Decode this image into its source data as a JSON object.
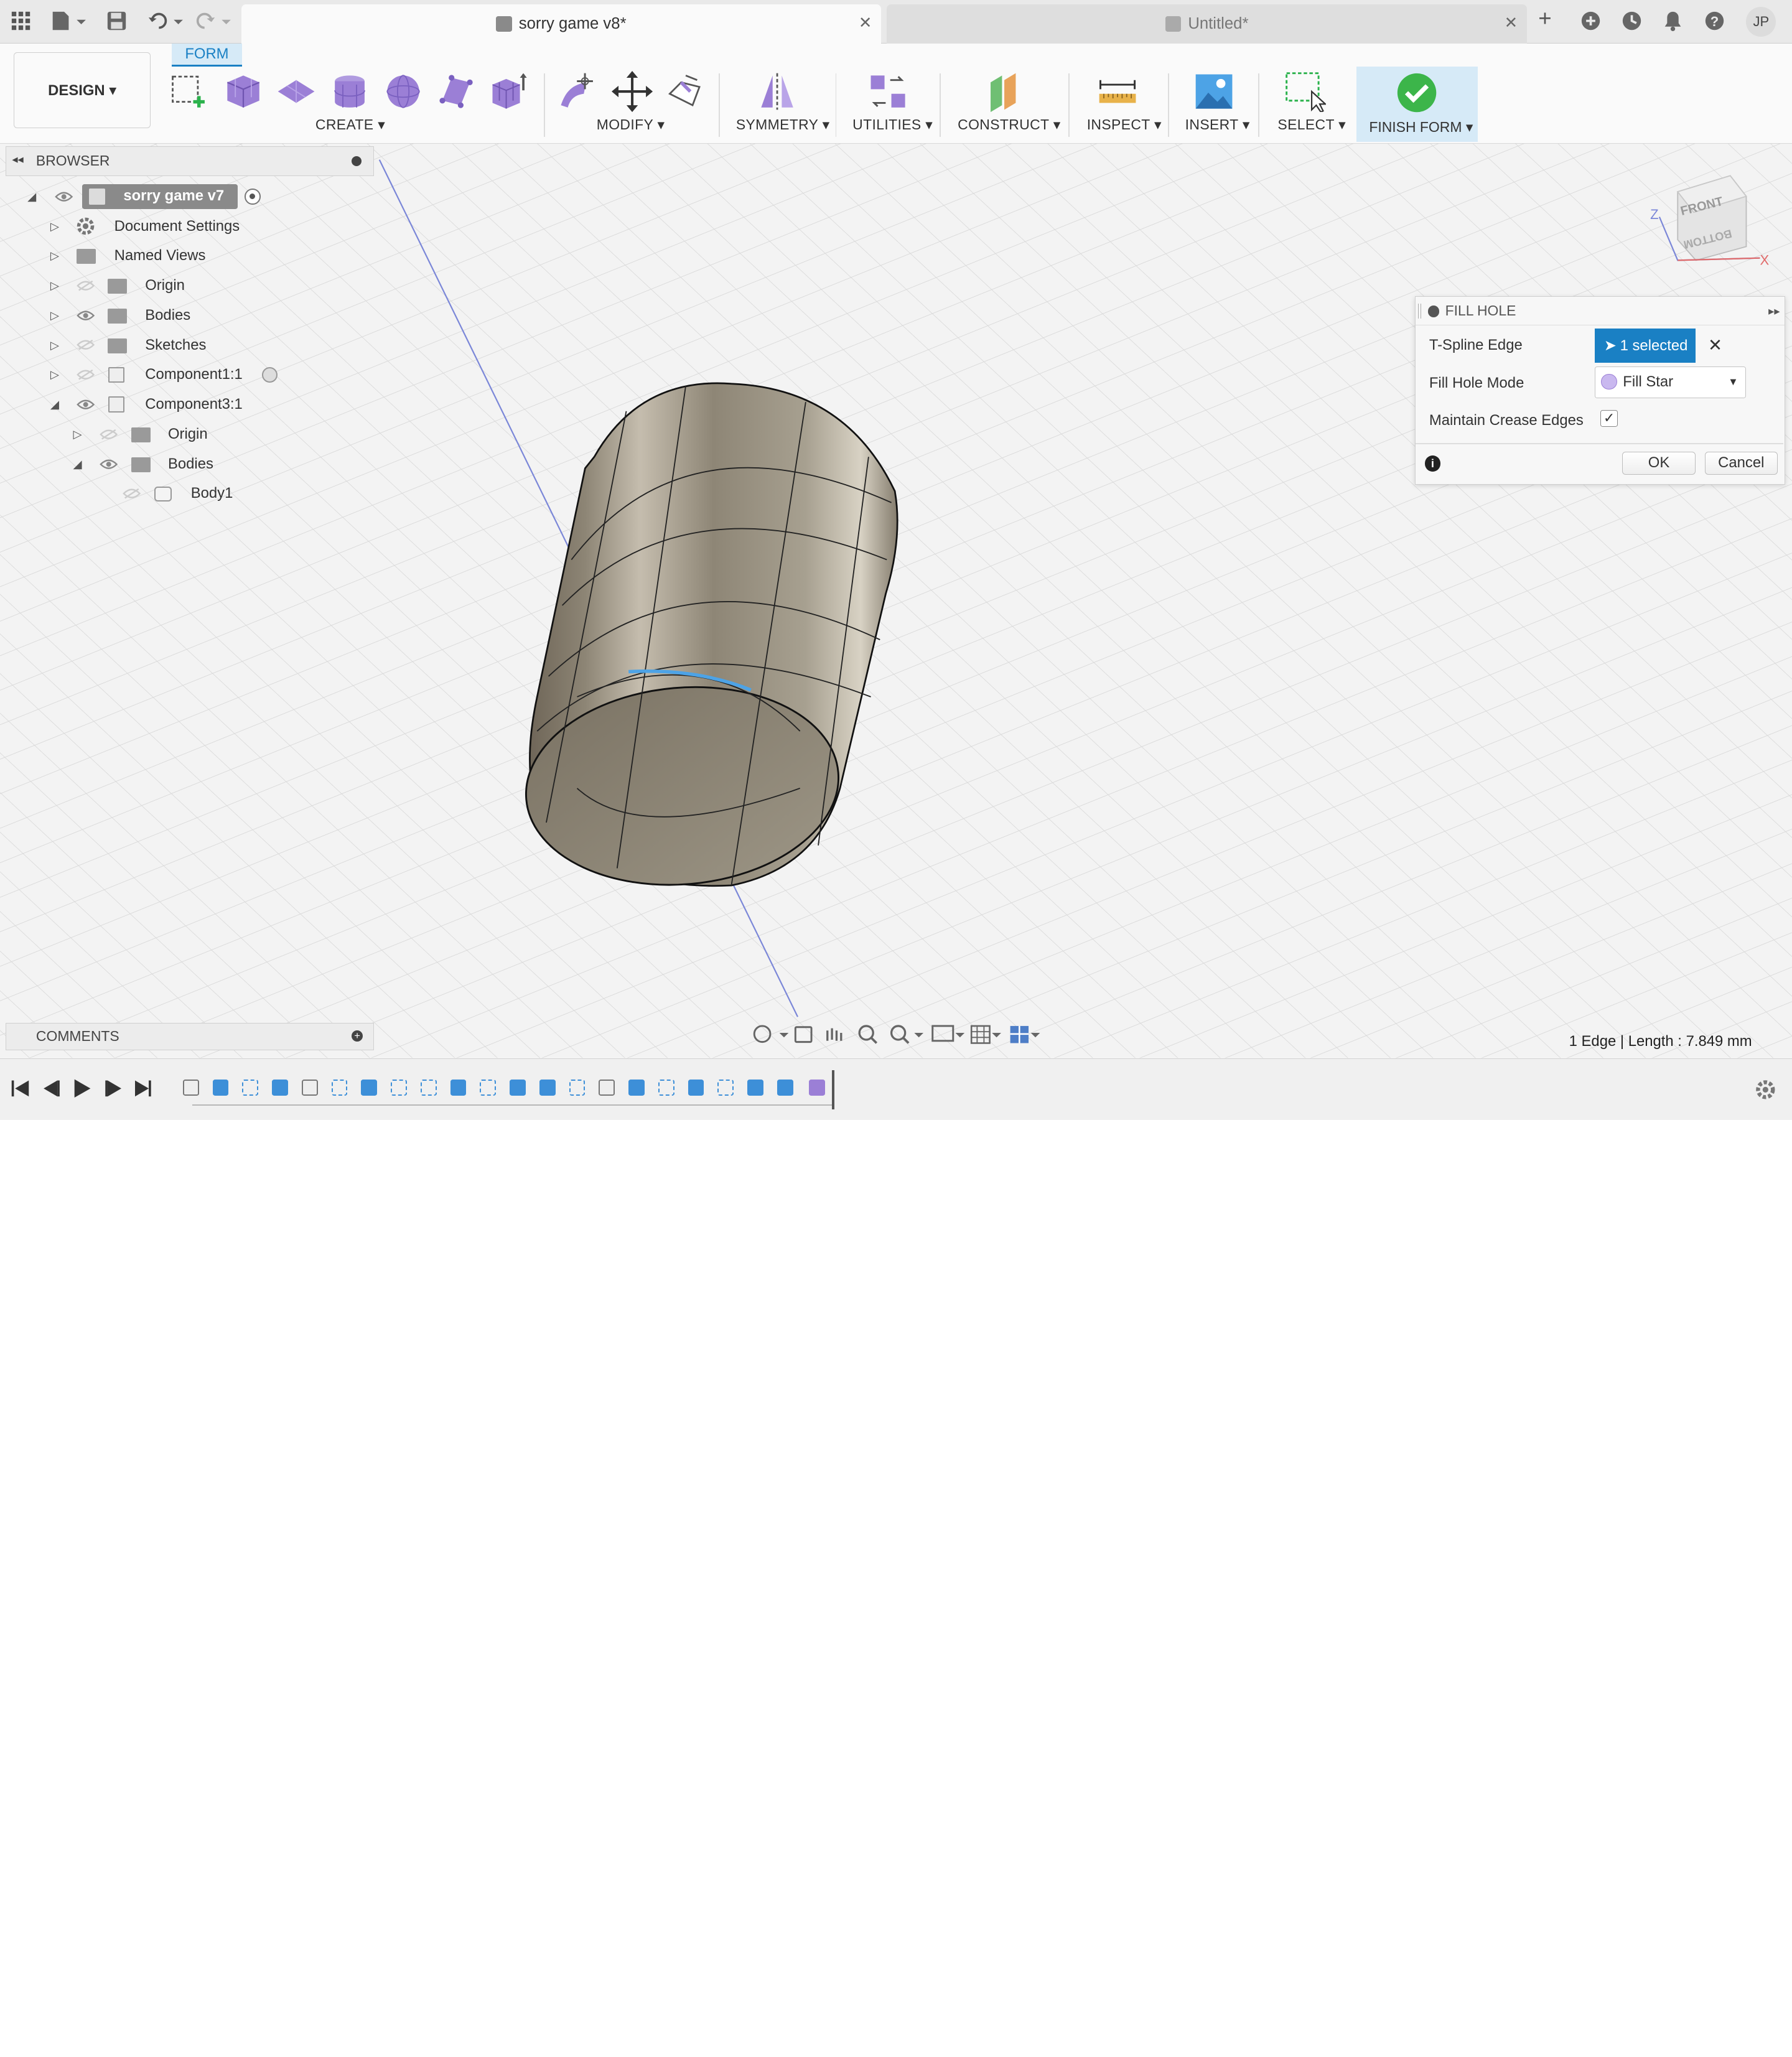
{
  "tabs": [
    {
      "label": "sorry game v8*",
      "active": true
    },
    {
      "label": "Untitled*",
      "active": false
    }
  ],
  "user": {
    "initials": "JP"
  },
  "toolbar": {
    "form_tab": "FORM",
    "workspace": "DESIGN ▾",
    "groups": {
      "create": "CREATE ▾",
      "modify": "MODIFY ▾",
      "symmetry": "SYMMETRY ▾",
      "utilities": "UTILITIES ▾",
      "construct": "CONSTRUCT ▾",
      "inspect": "INSPECT ▾",
      "insert": "INSERT ▾",
      "select": "SELECT ▾",
      "finish": "FINISH FORM ▾"
    },
    "accent": "#1a80c4",
    "tool_purple": "#9b7fd6"
  },
  "browser": {
    "title": "BROWSER",
    "root": "sorry game v7",
    "items": [
      {
        "label": "Document Settings",
        "level": 1,
        "icon": "gear-icon"
      },
      {
        "label": "Named Views",
        "level": 1,
        "icon": "folder-icon"
      },
      {
        "label": "Origin",
        "level": 1,
        "icon": "folder-icon",
        "visible": false
      },
      {
        "label": "Bodies",
        "level": 1,
        "icon": "folder-icon",
        "visible": true
      },
      {
        "label": "Sketches",
        "level": 1,
        "icon": "folder-icon",
        "visible": false
      },
      {
        "label": "Component1:1",
        "level": 1,
        "icon": "component-icon",
        "visible": false
      },
      {
        "label": "Component3:1",
        "level": 1,
        "icon": "component-icon",
        "visible": true,
        "expanded": true
      },
      {
        "label": "Origin",
        "level": 2,
        "icon": "folder-icon",
        "visible": false
      },
      {
        "label": "Bodies",
        "level": 2,
        "icon": "folder-icon",
        "visible": true,
        "expanded": true
      },
      {
        "label": "Body1",
        "level": 3,
        "icon": "body-icon",
        "visible": false
      }
    ]
  },
  "viewcube": {
    "front": "FRONT",
    "bottom": "BOTTOM",
    "axis_z": "Z",
    "axis_x": "X"
  },
  "dialog": {
    "title": "FILL HOLE",
    "tspline_edge_label": "T-Spline Edge",
    "tspline_edge_value": "1 selected",
    "fill_mode_label": "Fill Hole Mode",
    "fill_mode_value": "Fill Star",
    "crease_label": "Maintain Crease Edges",
    "crease_checked": true,
    "ok": "OK",
    "cancel": "Cancel"
  },
  "comments": {
    "title": "COMMENTS"
  },
  "status": {
    "text": "1 Edge | Length : 7.849 mm"
  }
}
